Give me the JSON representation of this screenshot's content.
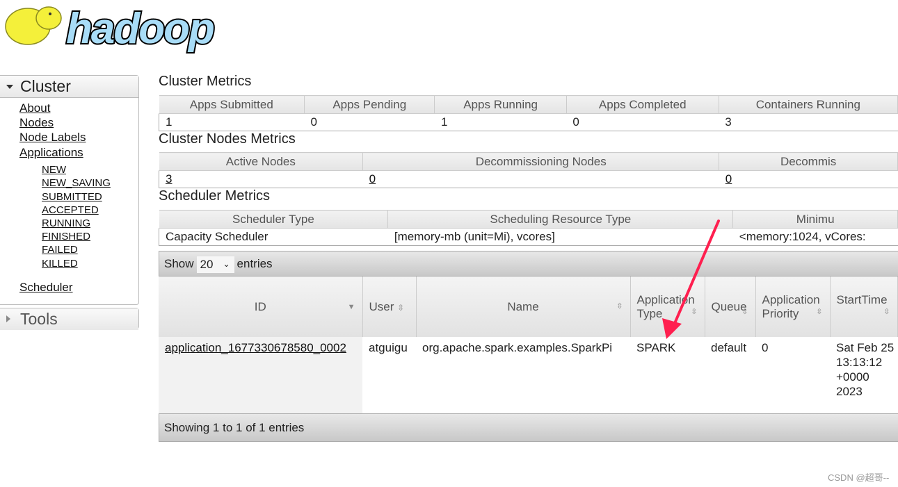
{
  "logo": {
    "text": "hadoop"
  },
  "sidebar": {
    "cluster_title": "Cluster",
    "tools_title": "Tools",
    "links": [
      "About",
      "Nodes",
      "Node Labels",
      "Applications"
    ],
    "app_states": [
      "NEW",
      "NEW_SAVING",
      "SUBMITTED",
      "ACCEPTED",
      "RUNNING",
      "FINISHED",
      "FAILED",
      "KILLED"
    ],
    "scheduler": "Scheduler"
  },
  "cluster_metrics": {
    "title": "Cluster Metrics",
    "headers": [
      "Apps Submitted",
      "Apps Pending",
      "Apps Running",
      "Apps Completed",
      "Containers Running"
    ],
    "values": [
      "1",
      "0",
      "1",
      "0",
      "3"
    ]
  },
  "nodes_metrics": {
    "title": "Cluster Nodes Metrics",
    "headers": [
      "Active Nodes",
      "Decommissioning Nodes",
      "Decommis"
    ],
    "values": [
      "3",
      "0",
      "0"
    ]
  },
  "scheduler_metrics": {
    "title": "Scheduler Metrics",
    "headers": [
      "Scheduler Type",
      "Scheduling Resource Type",
      "Minimu"
    ],
    "values": [
      "Capacity Scheduler",
      "[memory-mb (unit=Mi), vcores]",
      "<memory:1024, vCores:"
    ]
  },
  "apps": {
    "show": "Show",
    "page_size": "20",
    "entries": "entries",
    "headers": [
      "ID",
      "User",
      "Name",
      "Application Type",
      "Queue",
      "Application Priority",
      "StartTime"
    ],
    "rows": [
      [
        "application_1677330678580_0002",
        "atguigu",
        "org.apache.spark.examples.SparkPi",
        "SPARK",
        "default",
        "0",
        "Sat Feb 25 13:13:12 +0000 2023"
      ]
    ],
    "footer": "Showing 1 to 1 of 1 entries"
  },
  "annotation": {
    "arrow_color": "#ff1f4f"
  },
  "watermark": "CSDN @超哥--"
}
